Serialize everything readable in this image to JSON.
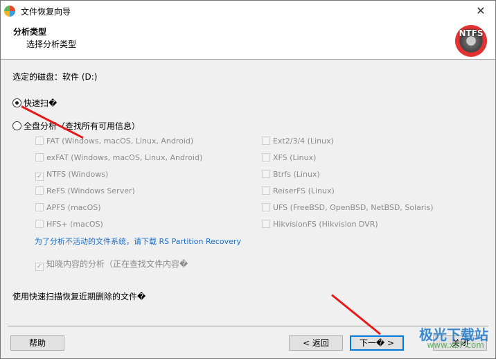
{
  "window": {
    "title": "文件恢复向导",
    "close": "✕"
  },
  "header": {
    "title": "分析类型",
    "subtitle": "选择分析类型",
    "logo": "NTFS"
  },
  "disk_label": "选定的磁盘：软件 (D:)",
  "options": {
    "quick": "快速扫�",
    "full": "全盘分析（查找所有可用信息）"
  },
  "fs_left": [
    {
      "label": "FAT (Windows, macOS, Linux, Android)",
      "checked": false
    },
    {
      "label": "exFAT (Windows, macOS, Linux, Android)",
      "checked": false
    },
    {
      "label": "NTFS (Windows)",
      "checked": true
    },
    {
      "label": "ReFS (Windows Server)",
      "checked": false
    },
    {
      "label": "APFS (macOS)",
      "checked": false
    },
    {
      "label": "HFS+ (macOS)",
      "checked": false
    }
  ],
  "fs_right": [
    {
      "label": "Ext2/3/4 (Linux)",
      "checked": false
    },
    {
      "label": "XFS (Linux)",
      "checked": false
    },
    {
      "label": "Btrfs (Linux)",
      "checked": false
    },
    {
      "label": "ReiserFS (Linux)",
      "checked": false
    },
    {
      "label": "UFS (FreeBSD, OpenBSD, NetBSD, Solaris)",
      "checked": false
    },
    {
      "label": "HikvisionFS (Hikvision DVR)",
      "checked": false
    }
  ],
  "link_text": "为了分析不活动的文件系统，请下载 RS Partition Recovery",
  "content_analysis": "知晓内容的分析（正在查找文件内容�",
  "description": "使用快速扫描恢复近期删除的文件�",
  "buttons": {
    "help": "帮助",
    "back": "< 返回",
    "next": "下一� >",
    "close": "关闭"
  },
  "watermark": {
    "name": "极光下载站",
    "url": "www.xz7.com"
  }
}
